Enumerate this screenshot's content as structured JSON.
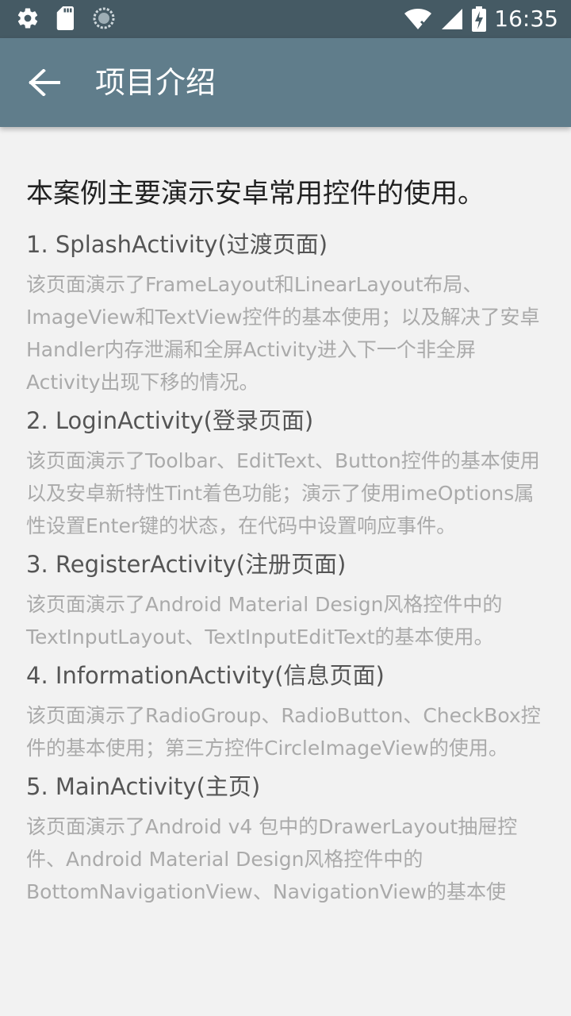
{
  "status_bar": {
    "time": "16:35",
    "icons": [
      "gear-icon",
      "sd-card-icon",
      "sync-icon",
      "wifi-icon",
      "signal-icon",
      "battery-charging-icon"
    ]
  },
  "app_bar": {
    "title": "项目介绍",
    "back_icon": "arrow-left-icon"
  },
  "content": {
    "intro": "本案例主要演示安卓常用控件的使用。",
    "sections": [
      {
        "title": "1. SplashActivity(过渡页面)",
        "desc": "该页面演示了FrameLayout和LinearLayout布局、ImageView和TextView控件的基本使用；以及解决了安卓Handler内存泄漏和全屏Activity进入下一个非全屏Activity出现下移的情况。"
      },
      {
        "title": "2. LoginActivity(登录页面)",
        "desc": "该页面演示了Toolbar、EditText、Button控件的基本使用以及安卓新特性Tint着色功能；演示了使用imeOptions属性设置Enter键的状态，在代码中设置响应事件。"
      },
      {
        "title": "3. RegisterActivity(注册页面)",
        "desc": "该页面演示了Android Material Design风格控件中的TextInputLayout、TextInputEditText的基本使用。"
      },
      {
        "title": "4. InformationActivity(信息页面)",
        "desc": "该页面演示了RadioGroup、RadioButton、CheckBox控件的基本使用；第三方控件CircleImageView的使用。"
      },
      {
        "title": "5. MainActivity(主页)",
        "desc": "该页面演示了Android v4 包中的DrawerLayout抽屉控件、Android Material Design风格控件中的BottomNavigationView、NavigationView的基本使"
      }
    ]
  }
}
